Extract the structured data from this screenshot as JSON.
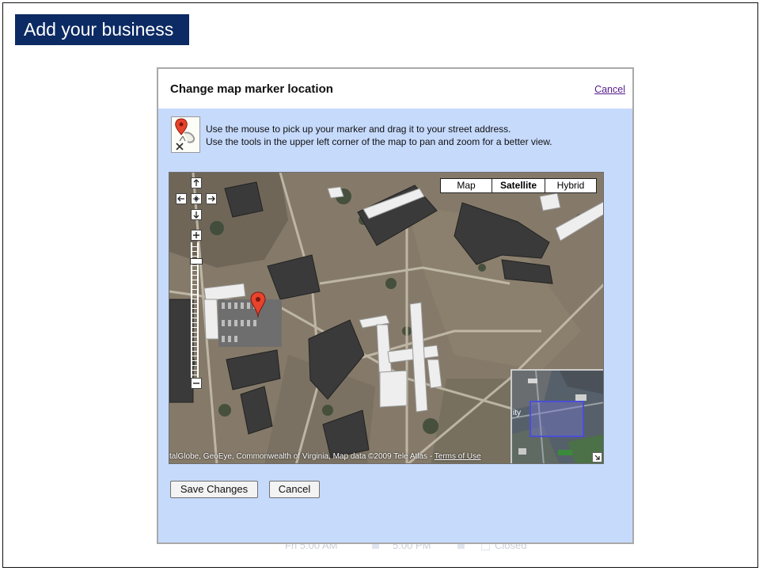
{
  "slide": {
    "title": "Add your business"
  },
  "background_hours": {
    "open_time": "Fri 5:00 AM",
    "close_time": "5:00 PM",
    "closed_label": "Closed"
  },
  "dialog": {
    "title": "Change map marker location",
    "cancel_link": "Cancel",
    "instructions": [
      "Use the mouse to pick up your marker and drag it to your street address.",
      "Use the tools in the upper left corner of the map to pan and zoom for a better view."
    ],
    "map": {
      "map_types": [
        "Map",
        "Satellite",
        "Hybrid"
      ],
      "selected_map_type": "Satellite",
      "copyright": "talGlobe, GeoEye, Commonwealth of Virginia, Map data ©2009 Tele Atlas - ",
      "terms_link": "Terms of Use",
      "overview_label": "ity"
    },
    "buttons": {
      "save": "Save Changes",
      "cancel": "Cancel"
    }
  },
  "colors": {
    "title_bar": "#0c2a63",
    "dialog_bg": "#c6dafc",
    "marker": "#e8432c"
  },
  "icons": [
    "marker-drag-icon",
    "pan-up-icon",
    "pan-left-icon",
    "pan-center-icon",
    "pan-right-icon",
    "pan-down-icon",
    "zoom-in-icon",
    "zoom-out-icon",
    "map-marker-icon",
    "overview-toggle-icon"
  ]
}
